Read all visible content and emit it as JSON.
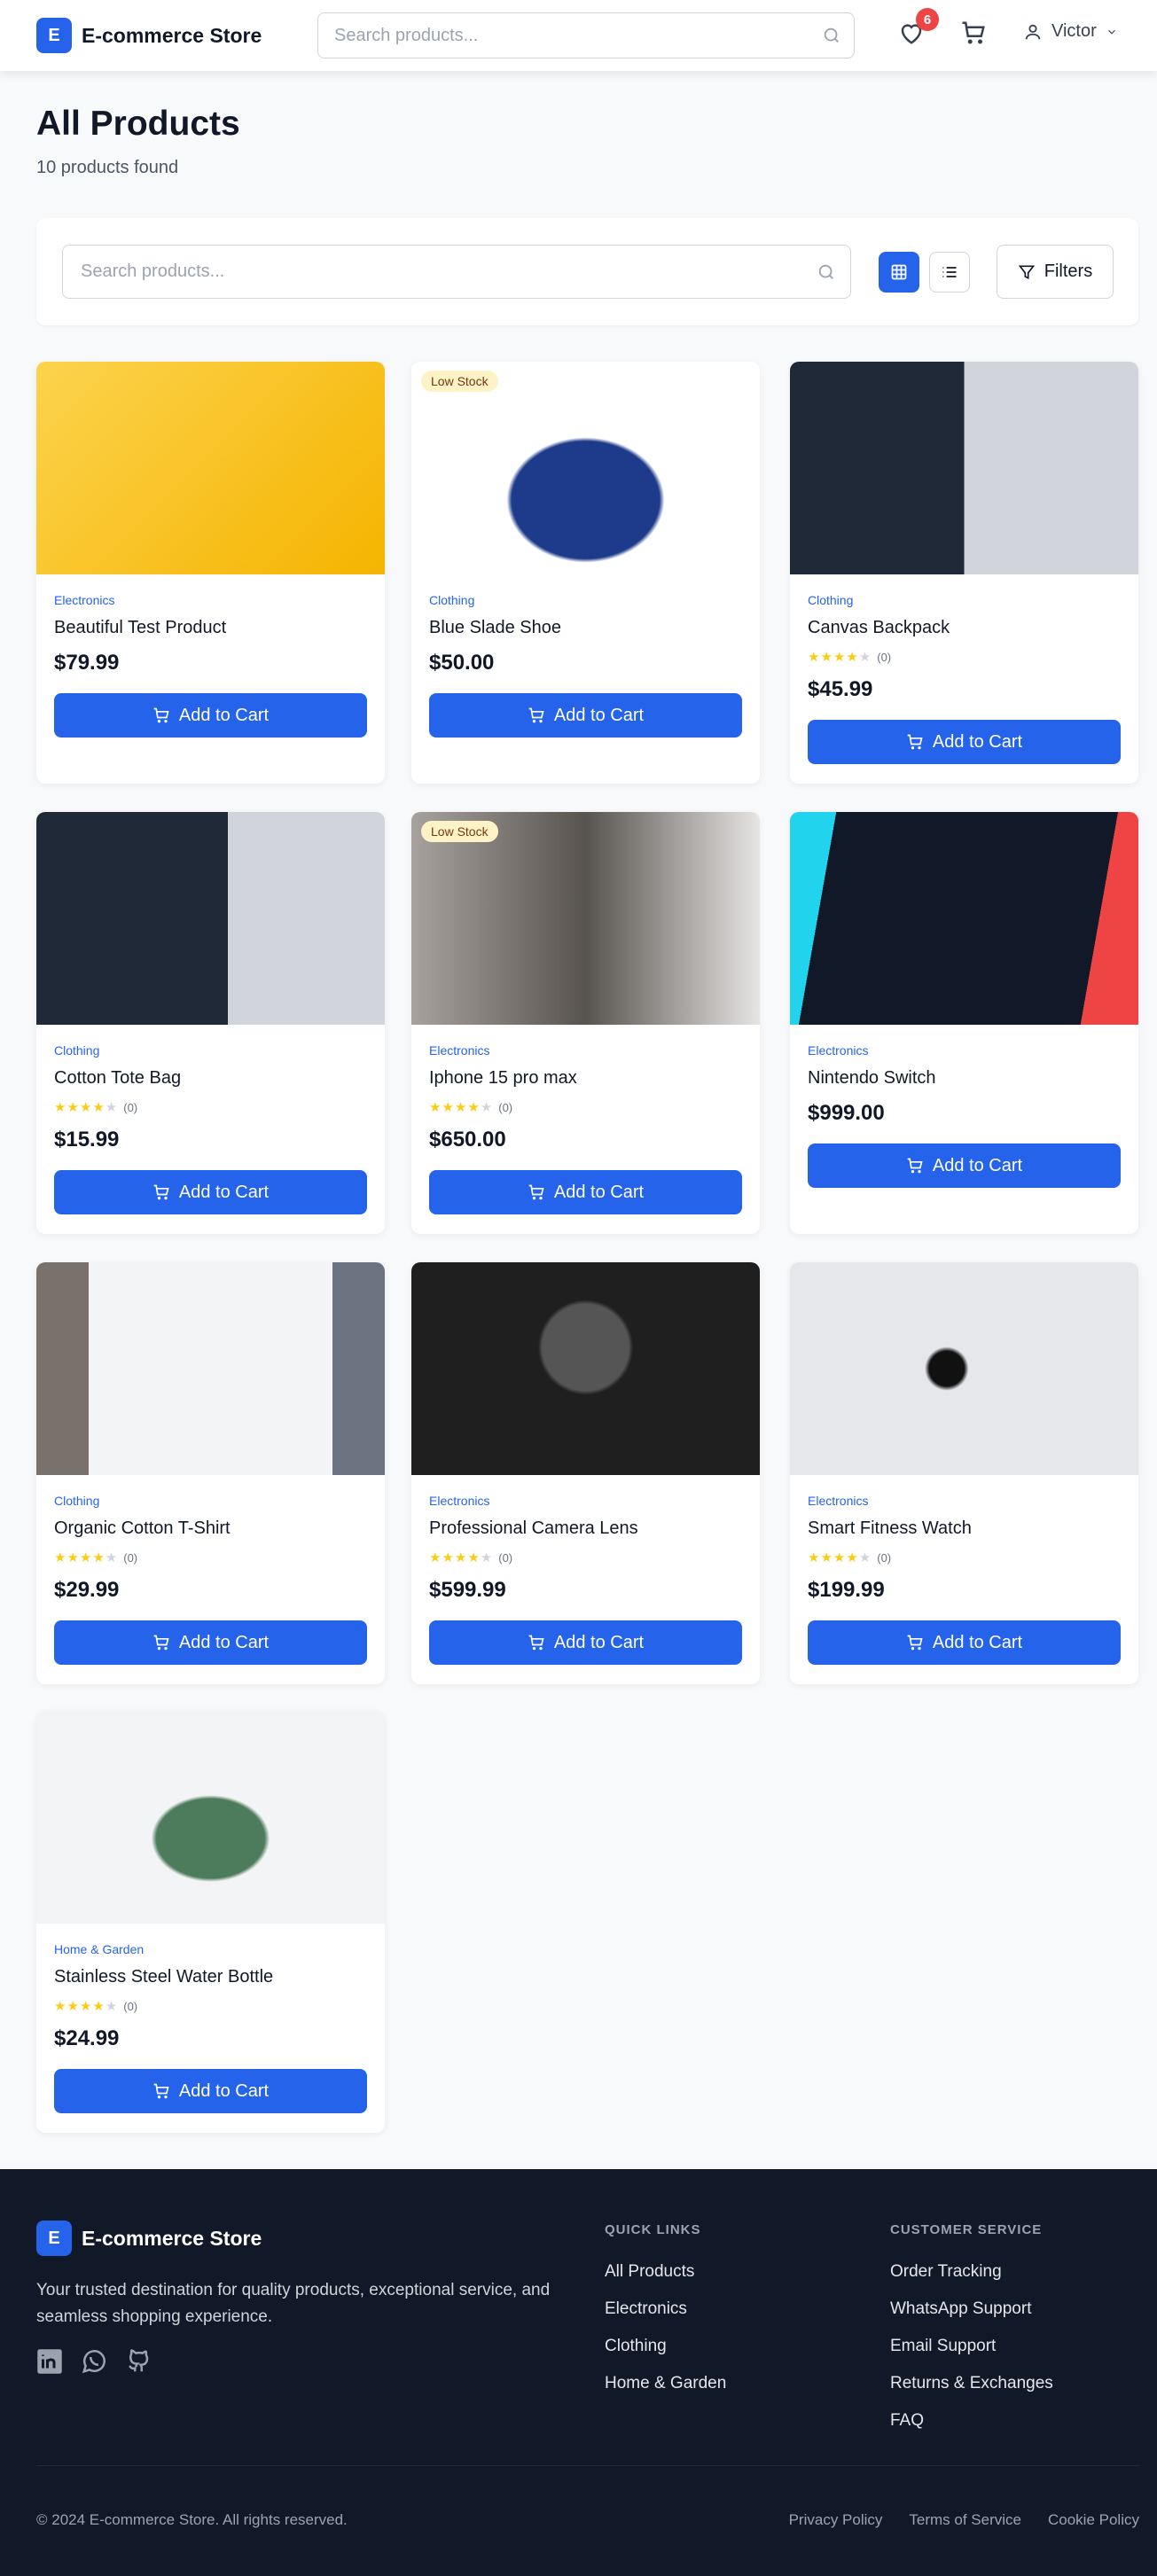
{
  "header": {
    "brand_letter": "E",
    "brand": "E-commerce Store",
    "search_placeholder": "Search products...",
    "wishlist_count": "6",
    "user": "Victor"
  },
  "page": {
    "title": "All Products",
    "count": "10 products found"
  },
  "toolbar": {
    "search_placeholder": "Search products...",
    "filters": "Filters"
  },
  "cart_label": "Add to Cart",
  "products": [
    {
      "category": "Electronics",
      "name": "Beautiful Test Product",
      "price": "$79.99"
    },
    {
      "category": "Clothing",
      "name": "Blue Slade Shoe",
      "price": "$50.00",
      "badge": "Low Stock"
    },
    {
      "category": "Clothing",
      "name": "Canvas Backpack",
      "price": "$45.99",
      "rating": 4,
      "reviews": "(0)"
    },
    {
      "category": "Clothing",
      "name": "Cotton Tote Bag",
      "price": "$15.99",
      "rating": 4,
      "reviews": "(0)"
    },
    {
      "category": "Electronics",
      "name": "Iphone 15 pro max",
      "price": "$650.00",
      "rating": 4,
      "reviews": "(0)",
      "badge": "Low Stock"
    },
    {
      "category": "Electronics",
      "name": "Nintendo Switch",
      "price": "$999.00"
    },
    {
      "category": "Clothing",
      "name": "Organic Cotton T-Shirt",
      "price": "$29.99",
      "rating": 4,
      "reviews": "(0)"
    },
    {
      "category": "Electronics",
      "name": "Professional Camera Lens",
      "price": "$599.99",
      "rating": 4,
      "reviews": "(0)"
    },
    {
      "category": "Electronics",
      "name": "Smart Fitness Watch",
      "price": "$199.99",
      "rating": 4,
      "reviews": "(0)"
    },
    {
      "category": "Home & Garden",
      "name": "Stainless Steel Water Bottle",
      "price": "$24.99",
      "rating": 4,
      "reviews": "(0)"
    }
  ],
  "footer": {
    "brand": "E-commerce Store",
    "description": "Your trusted destination for quality products, exceptional service, and seamless shopping experience.",
    "quick_links": {
      "title": "QUICK LINKS",
      "items": [
        "All Products",
        "Electronics",
        "Clothing",
        "Home & Garden"
      ]
    },
    "customer_service": {
      "title": "CUSTOMER SERVICE",
      "items": [
        "Order Tracking",
        "WhatsApp Support",
        "Email Support",
        "Returns & Exchanges",
        "FAQ"
      ]
    },
    "copyright": "© 2024 E-commerce Store. All rights reserved.",
    "legal": [
      "Privacy Policy",
      "Terms of Service",
      "Cookie Policy"
    ]
  },
  "colors": {
    "accent": "#2563eb",
    "footer_bg": "#111827",
    "badge": "#ef4444"
  }
}
